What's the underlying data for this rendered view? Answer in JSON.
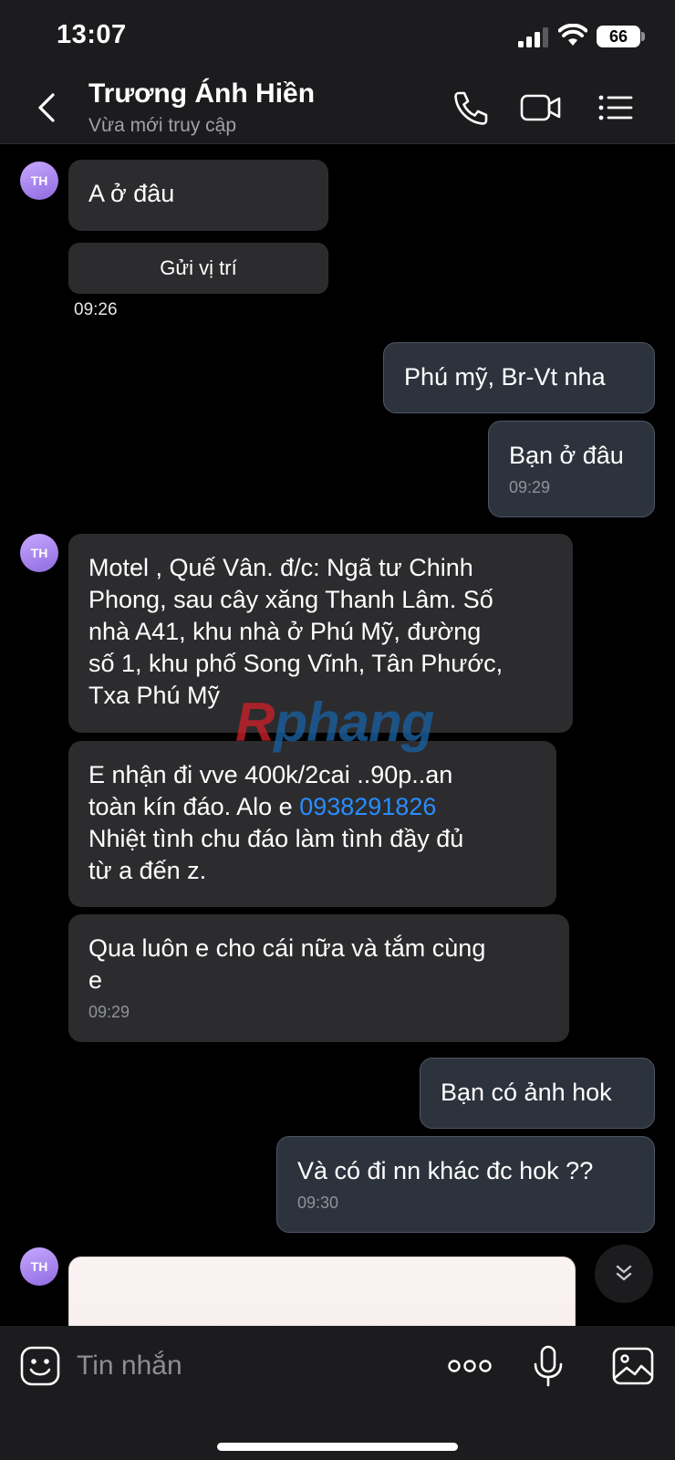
{
  "status_bar": {
    "time": "13:07",
    "battery": "66"
  },
  "header": {
    "contact_name": "Trương Ánh Hiền",
    "contact_status": "Vừa mới truy cập",
    "icons": [
      "back-icon",
      "phone-icon",
      "video-call-icon",
      "menu-list-icon"
    ]
  },
  "chat": {
    "avatar_initials": "TH",
    "messages": [
      {
        "dir": "in",
        "text": "A ở đâu"
      },
      {
        "dir": "in",
        "type": "location_button",
        "label": "Gửi vị trí",
        "time": "09:26"
      },
      {
        "dir": "out",
        "text": "Phú mỹ, Br-Vt nha"
      },
      {
        "dir": "out",
        "text": "Bạn ở đâu",
        "time": "09:29"
      },
      {
        "dir": "in",
        "text": "Motel , Quế Vân. đ/c: Ngã tư Chinh\nPhong, sau cây xăng Thanh Lâm. Số\nnhà A41, khu nhà ở Phú Mỹ, đường\nsố 1, khu phố Song Vĩnh, Tân Phước,\nTxa Phú Mỹ"
      },
      {
        "dir": "in",
        "text_before": "E nhận đi vve 400k/2cai ..90p..an\ntoàn kín đáo. Alo e ",
        "phone": "0938291826",
        "text_after": "\nNhiệt tình chu đáo làm tình đầy đủ\ntừ a đến z."
      },
      {
        "dir": "in",
        "text": "Qua luôn e cho cái nữa và tắm cùng\ne",
        "time": "09:29"
      },
      {
        "dir": "out",
        "text": "Bạn có ảnh hok"
      },
      {
        "dir": "out",
        "text": "Và có đi nn khác đc hok ??",
        "time": "09:30"
      },
      {
        "dir": "in",
        "type": "image"
      }
    ],
    "watermark": {
      "r": "R",
      "rest": "phang"
    }
  },
  "input_bar": {
    "placeholder": "Tin nhắn",
    "icons": [
      "sticker-icon",
      "more-options-icon",
      "microphone-icon",
      "gallery-icon"
    ]
  },
  "colors": {
    "incoming_bubble": "#2c2c2e",
    "outgoing_bubble": "#2d333d",
    "link": "#2a8cff",
    "avatar": "#a888f0"
  }
}
